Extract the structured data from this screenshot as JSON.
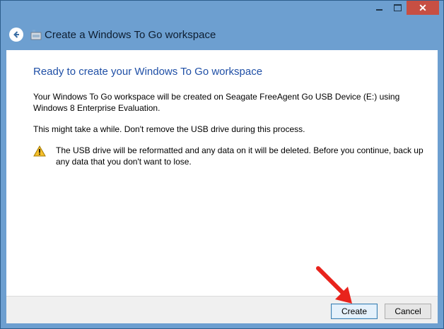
{
  "window": {
    "controls": {
      "minimize": "minimize",
      "maximize": "maximize",
      "close": "✕"
    },
    "title": "Create a Windows To Go workspace"
  },
  "content": {
    "heading": "Ready to create your Windows To Go workspace",
    "paragraph1": "Your Windows To Go workspace will be created on Seagate FreeAgent Go USB Device (E:) using Windows 8 Enterprise Evaluation.",
    "paragraph2": "This might take a while. Don't remove the USB drive during this process.",
    "warning": "The USB drive will be reformatted and any data on it will be deleted. Before you continue, back up any data that you don't want to lose."
  },
  "footer": {
    "create_label": "Create",
    "cancel_label": "Cancel"
  },
  "icons": {
    "back": "back-arrow-icon",
    "usb": "usb-drive-icon",
    "warning": "warning-icon",
    "annotation": "red-arrow-annotation"
  },
  "colors": {
    "heading": "#1f4fa6",
    "frame": "#6d9fd0",
    "close_button": "#c74f43",
    "annotation_arrow": "#e8231c"
  }
}
